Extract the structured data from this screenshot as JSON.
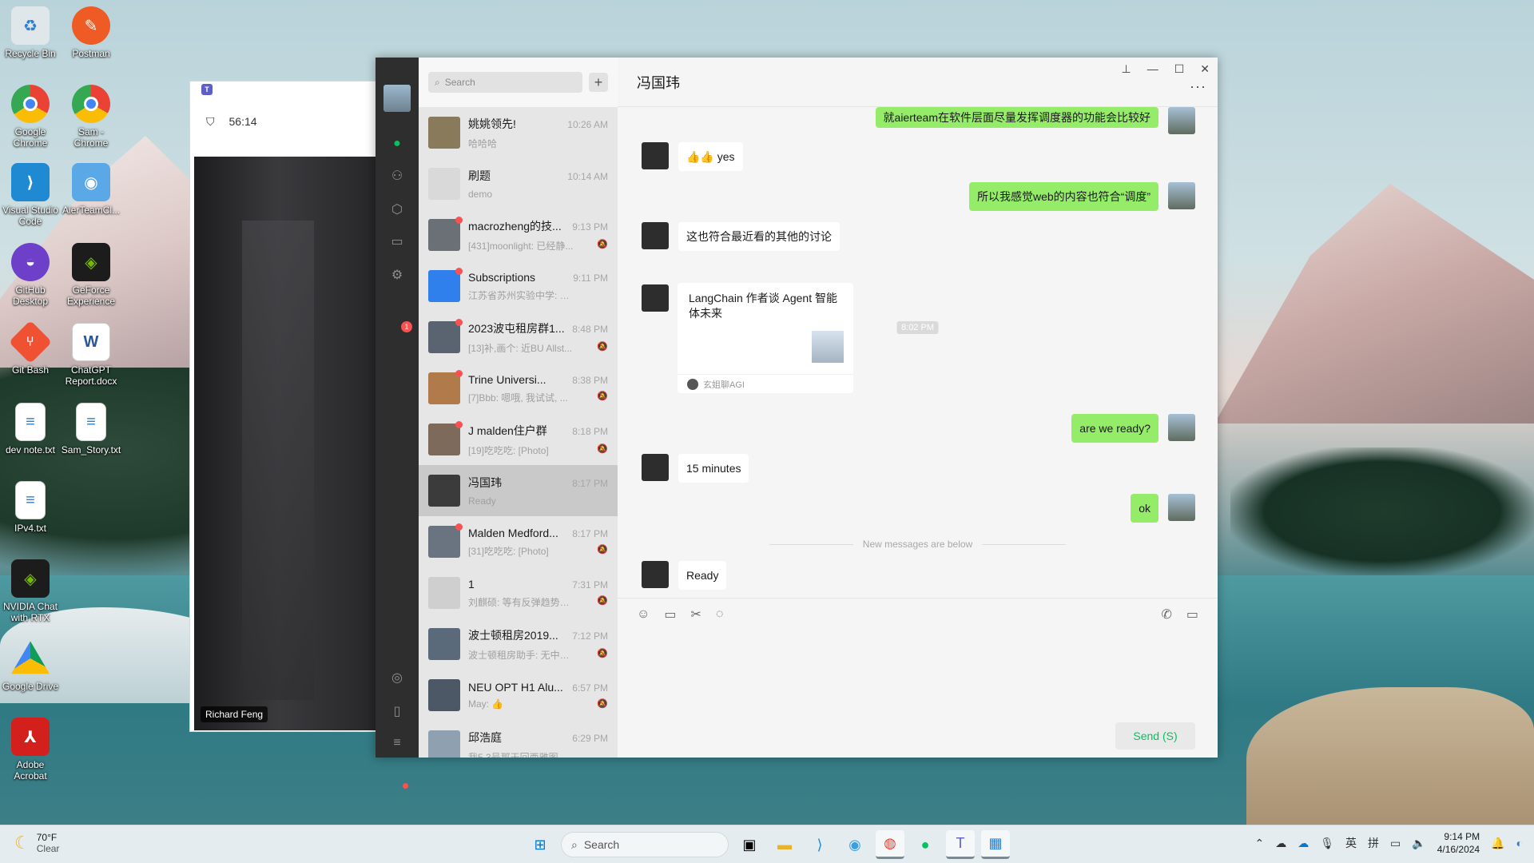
{
  "desktop": {
    "icons": [
      {
        "label": "Recycle Bin"
      },
      {
        "label": "Postman"
      },
      {
        "label": "Google Chrome"
      },
      {
        "label": "Sam - Chrome"
      },
      {
        "label": "Visual Studio Code"
      },
      {
        "label": "AierTeamCl..."
      },
      {
        "label": "GitHub Desktop"
      },
      {
        "label": "GeForce Experience"
      },
      {
        "label": "Git Bash"
      },
      {
        "label": "ChatGPT Report.docx"
      },
      {
        "label": "dev note.txt"
      },
      {
        "label": "Sam_Story.txt"
      },
      {
        "label": "IPv4.txt"
      },
      {
        "label": "NVIDIA Chat with RTX"
      },
      {
        "label": "Google Drive"
      },
      {
        "label": "Adobe Acrobat"
      }
    ]
  },
  "teams": {
    "timer": "56:14",
    "participant": "Richard Feng"
  },
  "wechat": {
    "search_placeholder": "Search",
    "chats": [
      {
        "name": "姚姚领先!",
        "time": "10:26 AM",
        "preview": "哈哈哈",
        "color": "#8a7a5c",
        "unread": false,
        "muted": false
      },
      {
        "name": "刷题",
        "time": "10:14 AM",
        "preview": "demo",
        "color": "#d9d9d9",
        "unread": false,
        "muted": false
      },
      {
        "name": "macrozheng的技...",
        "time": "9:13 PM",
        "preview": "[431]moonlight: 已经静...",
        "color": "#6b6f76",
        "unread": true,
        "muted": true
      },
      {
        "name": "Subscriptions",
        "time": "9:11 PM",
        "preview": "江苏省苏州实验中学: 英姿\"...",
        "color": "#2f80ed",
        "unread": true,
        "muted": false
      },
      {
        "name": "2023波屯租房群1...",
        "time": "8:48 PM",
        "preview": "[13]补,画个: 近BU Allst...",
        "color": "#5a6470",
        "unread": true,
        "muted": true
      },
      {
        "name": "Trine Universi...",
        "time": "8:38 PM",
        "preview": "[7]Bbb: 嗯哦, 我试试, ...",
        "color": "#b07a4a",
        "unread": true,
        "muted": true
      },
      {
        "name": "J malden住户群",
        "time": "8:18 PM",
        "preview": "[19]吃吃吃: [Photo]",
        "color": "#7d6a5a",
        "unread": true,
        "muted": true
      },
      {
        "name": "冯国玮",
        "time": "8:17 PM",
        "preview": "Ready",
        "color": "#3b3b3b",
        "unread": false,
        "muted": false
      },
      {
        "name": "Malden Medford...",
        "time": "8:17 PM",
        "preview": "[31]吃吃吃: [Photo]",
        "color": "#6a7480",
        "unread": true,
        "muted": true
      },
      {
        "name": "1",
        "time": "7:31 PM",
        "preview": "刘麒硕: 等有反弹趋势后...",
        "color": "#cfcfcf",
        "unread": false,
        "muted": true
      },
      {
        "name": "波士顿租房2019...",
        "time": "7:12 PM",
        "preview": "波士顿租房助手: 无中介...",
        "color": "#5b6a7a",
        "unread": false,
        "muted": true
      },
      {
        "name": "NEU OPT H1 Alu...",
        "time": "6:57 PM",
        "preview": "May: 👍",
        "color": "#4d5866",
        "unread": false,
        "muted": true
      },
      {
        "name": "邱浩庭",
        "time": "6:29 PM",
        "preview": "我5.3号那天回西雅图",
        "color": "#8fa0b0",
        "unread": false,
        "muted": false
      }
    ],
    "active_chat_title": "冯国玮",
    "messages": {
      "m1": "就aierteam在软件层面尽量发挥调度器的功能会比较好",
      "m2": "👍👍 yes",
      "m3": "所以我感觉web的内容也符合“调度”",
      "m4": "这也符合最近看的其他的讨论",
      "time_chip": "8:02 PM",
      "card_title": "LangChain 作者谈 Agent 智能体未来",
      "card_source": "玄姐聊AGI",
      "m5": "are we ready?",
      "m6": "15 minutes",
      "m7": "ok",
      "divider": "New messages are below",
      "m8": "Ready"
    },
    "send_label": "Send (S)",
    "nav_badge": "1"
  },
  "taskbar": {
    "temperature": "70°F",
    "condition": "Clear",
    "search_label": "Search",
    "time": "9:14 PM",
    "date": "4/16/2024",
    "ime1": "英",
    "ime2": "拼"
  }
}
